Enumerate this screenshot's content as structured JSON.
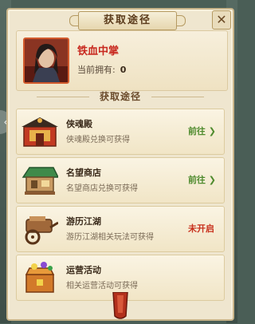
{
  "dialog": {
    "title": "获取途径",
    "close_glyph": "✕"
  },
  "item": {
    "name": "铁血中掌",
    "owned_label": "当前拥有:",
    "owned_count": "0",
    "icon": "portrait-icon"
  },
  "section": {
    "title": "获取途径"
  },
  "routes": [
    {
      "name": "侠魂殿",
      "desc": "侠魂殿兑换可获得",
      "action": "前往",
      "arrow": "❯",
      "icon": "shrine-icon",
      "available": true
    },
    {
      "name": "名望商店",
      "desc": "名望商店兑换可获得",
      "action": "前往",
      "arrow": "❯",
      "icon": "shop-icon",
      "available": true
    },
    {
      "name": "游历江湖",
      "desc": "游历江湖相关玩法可获得",
      "action": "未开启",
      "arrow": "",
      "icon": "cart-icon",
      "available": false
    },
    {
      "name": "运营活动",
      "desc": "相关运营活动可获得",
      "action": "",
      "arrow": "",
      "icon": "treasure-icon",
      "available": true
    }
  ],
  "side_nav": {
    "glyph": "‹"
  },
  "colors": {
    "accent": "#c8281e",
    "go": "#4f8b2e",
    "panel": "#efe6cf"
  }
}
